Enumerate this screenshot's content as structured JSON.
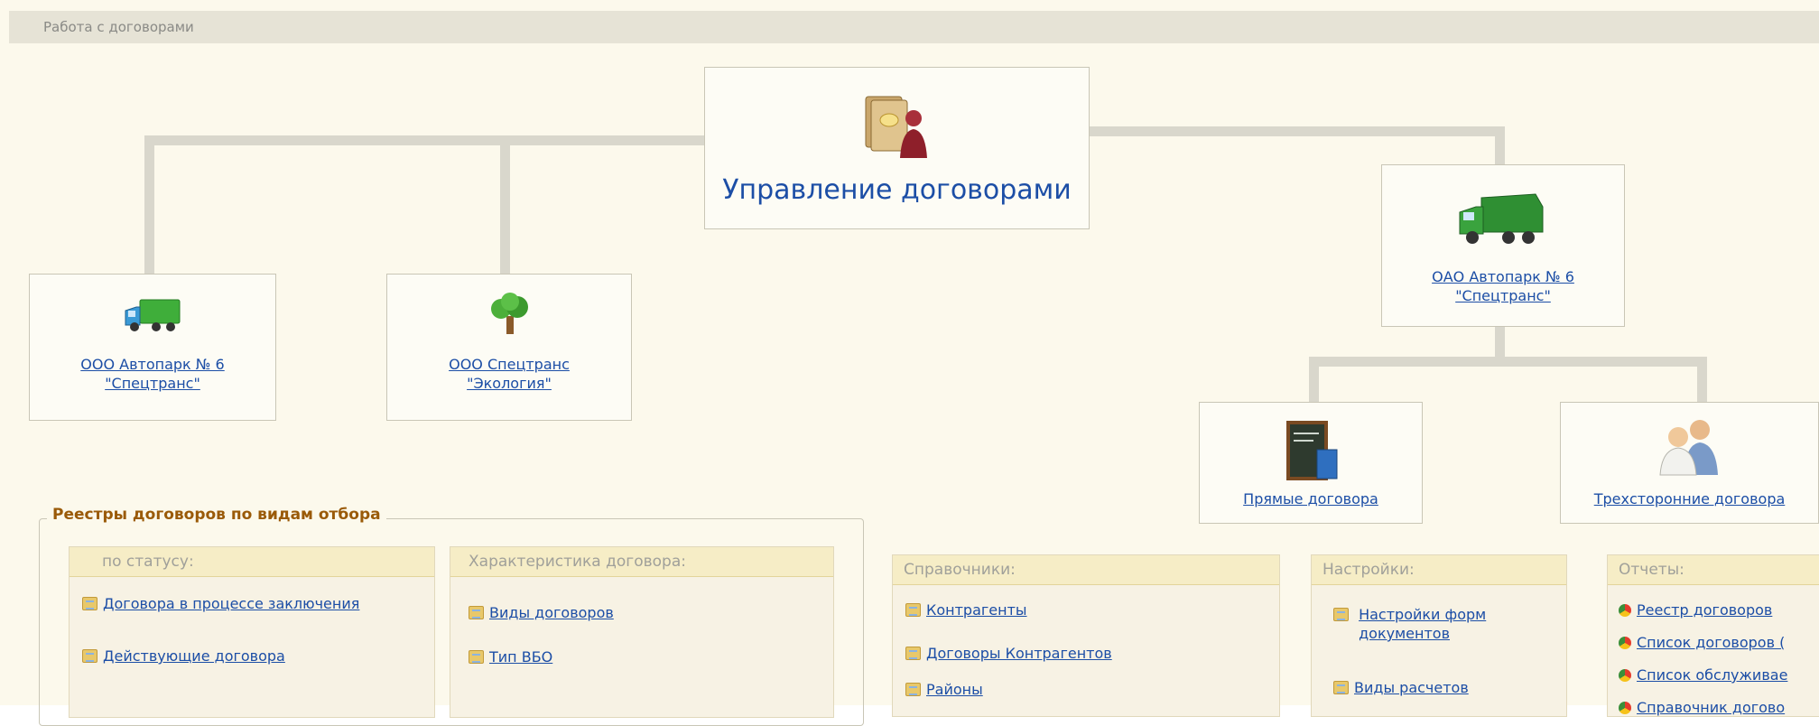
{
  "window": {
    "title": "Работа с договорами"
  },
  "tree": {
    "root": {
      "label": "Управление договорами",
      "icon": "contract-folder-person-icon"
    },
    "nodes": [
      {
        "label_line1": "ООО Автопарк № 6",
        "label_line2": "\"Спецтранс\"",
        "icon": "green-truck-icon"
      },
      {
        "label_line1": "ООО Спецтранс",
        "label_line2": "\"Экология\"",
        "icon": "tree-icon"
      },
      {
        "label_line1": "ОАО Автопарк № 6",
        "label_line2": "\"Спецтранс\"",
        "icon": "garbage-truck-icon"
      }
    ],
    "subnodes": [
      {
        "label": "Прямые договора",
        "icon": "chalkboard-book-icon"
      },
      {
        "label": "Трехсторонние договора",
        "icon": "two-people-icon"
      }
    ]
  },
  "registries": {
    "legend": "Реестры договоров по видам отбора",
    "groups": [
      {
        "title": "по статусу:",
        "items": [
          "Договора в процессе заключения",
          "Действующие договора"
        ]
      },
      {
        "title": "Характеристика договора:",
        "items": [
          "Виды договоров",
          "Тип ВБО"
        ]
      }
    ]
  },
  "panels": [
    {
      "title": "Справочники:",
      "items": [
        "Контрагенты",
        "Договоры Контрагентов",
        "Районы"
      ]
    },
    {
      "title": "Настройки:",
      "items_multiline": [
        [
          "Настройки форм",
          "документов"
        ]
      ],
      "items": [
        "Виды расчетов"
      ]
    },
    {
      "title": "Отчеты:",
      "items": [
        "Реестр договоров",
        "Список договоров (",
        "Список обслуживае",
        "Справочник догово"
      ]
    }
  ],
  "colors": {
    "link": "#1c4ea6",
    "legend": "#9a5a08",
    "background": "#fcf9ec",
    "titlebar": "#e6e3d6"
  }
}
